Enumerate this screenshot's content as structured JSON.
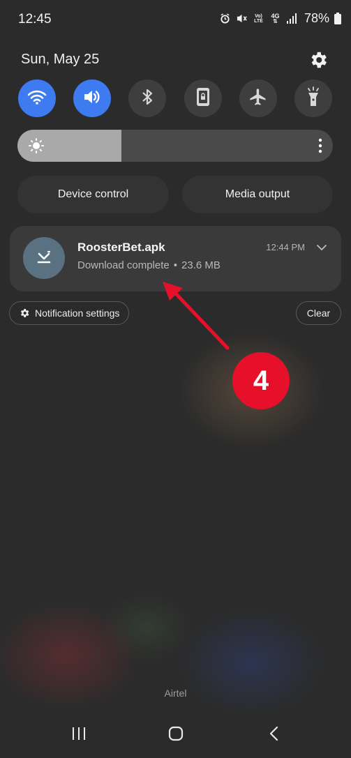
{
  "status_bar": {
    "time": "12:45",
    "network_label_top": "Vo)",
    "network_label_bottom": "LTE",
    "data_label": "4G",
    "battery": "78%"
  },
  "header": {
    "date": "Sun, May 25"
  },
  "quick_settings": [
    {
      "name": "wifi",
      "active": true,
      "icon": "wifi-icon"
    },
    {
      "name": "sound",
      "active": true,
      "icon": "speaker-icon"
    },
    {
      "name": "bluetooth",
      "active": false,
      "icon": "bluetooth-icon"
    },
    {
      "name": "portrait-lock",
      "active": false,
      "icon": "rotation-lock-icon"
    },
    {
      "name": "airplane-mode",
      "active": false,
      "icon": "airplane-icon"
    },
    {
      "name": "flashlight",
      "active": false,
      "icon": "flashlight-icon"
    }
  ],
  "brightness": {
    "level": 0.33
  },
  "actions": {
    "device_control": "Device control",
    "media_output": "Media output"
  },
  "notification": {
    "title": "RoosterBet.apk",
    "status": "Download complete",
    "separator": "•",
    "size": "23.6 MB",
    "time": "12:44 PM"
  },
  "footer_buttons": {
    "notification_settings": "Notification settings",
    "clear": "Clear"
  },
  "annotation": {
    "step": "4",
    "color": "#e6102a"
  },
  "carrier": "Airtel",
  "colors": {
    "accent": "#3e7bf0",
    "tile_off": "#3e3e3e",
    "notification_icon_bg": "#5a7182"
  }
}
